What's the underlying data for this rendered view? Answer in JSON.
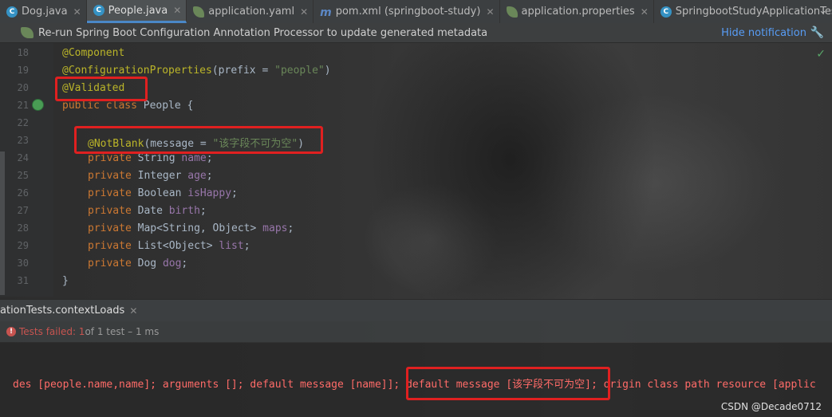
{
  "tabs": [
    {
      "label": "Dog.java",
      "icon": "java-class-icon"
    },
    {
      "label": "People.java",
      "icon": "java-class-icon",
      "active": true
    },
    {
      "label": "application.yaml",
      "icon": "spring-leaf-icon"
    },
    {
      "label": "pom.xml (springboot-study)",
      "icon": "maven-icon"
    },
    {
      "label": "application.properties",
      "icon": "spring-leaf-icon"
    },
    {
      "label": "SpringbootStudyApplicationTests.jav",
      "icon": "java-class-icon"
    }
  ],
  "notification": {
    "message": "Re-run Spring Boot Configuration Annotation Processor to update generated metadata",
    "hide_label": "Hide notification"
  },
  "code": {
    "line_numbers": [
      "18",
      "19",
      "20",
      "21",
      "22",
      "23",
      "24",
      "25",
      "26",
      "27",
      "28",
      "29",
      "30",
      "31"
    ],
    "line18": "@Component",
    "line19_ann": "@ConfigurationProperties",
    "line19_mid": "(prefix = ",
    "line19_str": "\"people\"",
    "line19_end": ")",
    "line20": "@Validated",
    "line21_kw": "public class",
    "line21_rest": " People {",
    "line23_ann": "@NotBlank",
    "line23_mid": "(message = ",
    "line23_str": "\"该字段不可为空\"",
    "line23_end": ")",
    "fields": [
      {
        "type": "String",
        "name": "name"
      },
      {
        "type": "Integer",
        "name": "age"
      },
      {
        "type": "Boolean",
        "name": "isHappy"
      },
      {
        "type": "Date",
        "name": "birth"
      },
      {
        "type": "Map<String, Object>",
        "name": "maps"
      },
      {
        "type": "List<Object>",
        "name": "list"
      },
      {
        "type": "Dog",
        "name": "dog"
      }
    ],
    "private_kw": "private",
    "line31": "}"
  },
  "run_tab": {
    "label": "ationTests.contextLoads"
  },
  "test_status": {
    "failed": "Tests failed: 1",
    "summary": " of 1 test – 1 ms"
  },
  "console": {
    "error_prefix": "des [people.name,name]; arguments []; default message [name]]; ",
    "error_highlight": "default message [该字段不可为空]",
    "error_suffix": "; origin class path resource [applic"
  },
  "watermark": "CSDN @Decade0712",
  "colors": {
    "annotation": "#bbb529",
    "keyword": "#cc7832",
    "string": "#6a8759",
    "field": "#9876aa",
    "error": "#ff6b68",
    "highlight_box": "#e02020"
  }
}
